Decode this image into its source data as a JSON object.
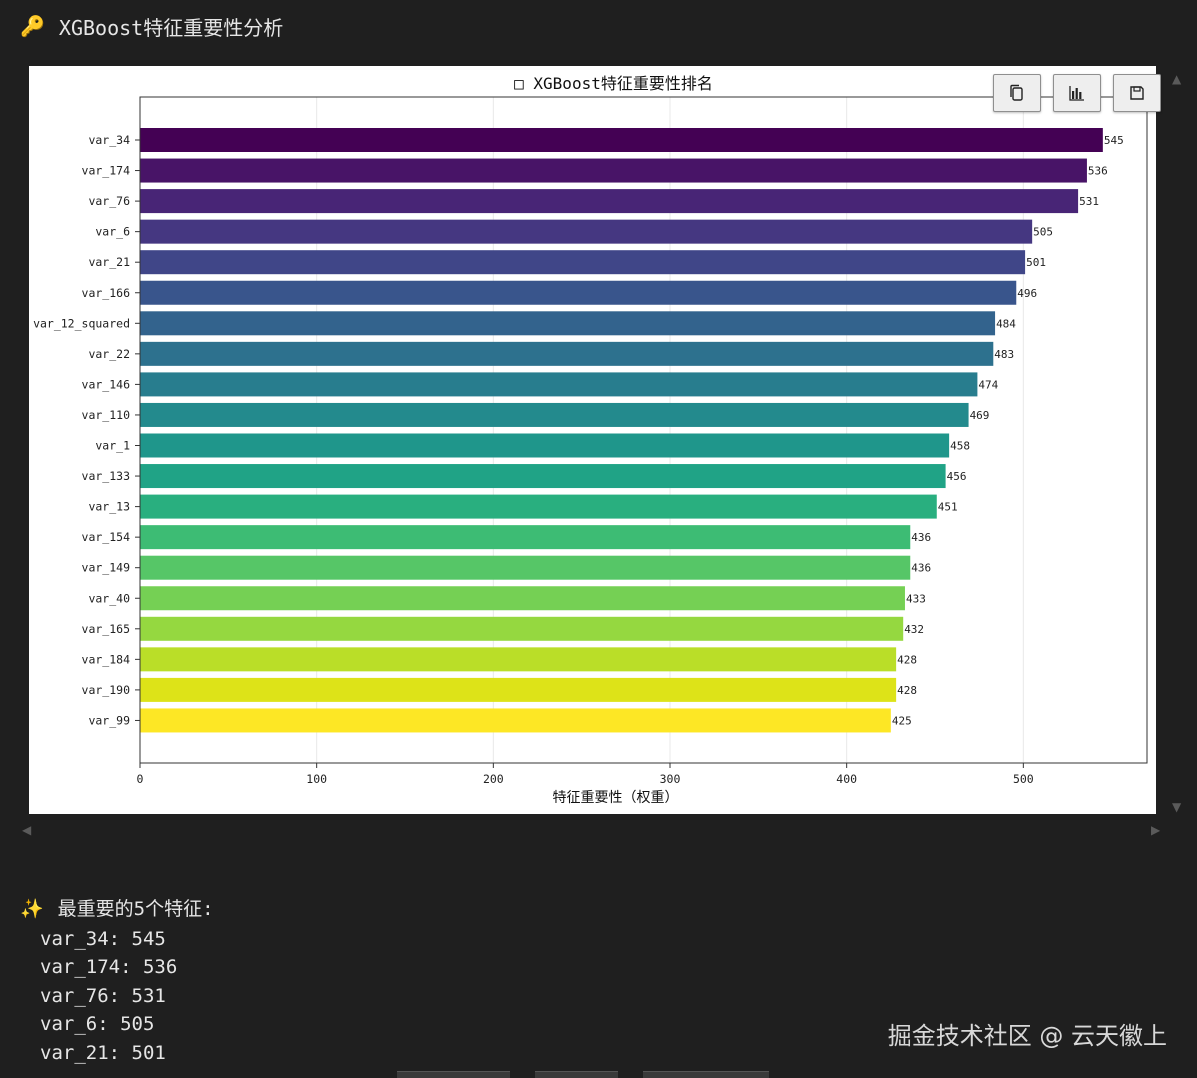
{
  "header": {
    "icon": "key-icon",
    "emoji": "🔑",
    "title": "XGBoost特征重要性分析"
  },
  "toolbar": {
    "buttons": [
      "copy-icon",
      "chart-icon",
      "save-icon"
    ]
  },
  "chart_data": {
    "type": "bar",
    "orientation": "horizontal",
    "title": "□ XGBoost特征重要性排名",
    "xlabel": "特征重要性（权重）",
    "ylabel": "",
    "xlim": [
      0,
      570
    ],
    "xticks": [
      0,
      100,
      200,
      300,
      400,
      500
    ],
    "grid": "vertical",
    "colormap": "viridis",
    "categories": [
      "var_34",
      "var_174",
      "var_76",
      "var_6",
      "var_21",
      "var_166",
      "var_12_squared",
      "var_22",
      "var_146",
      "var_110",
      "var_1",
      "var_133",
      "var_13",
      "var_154",
      "var_149",
      "var_40",
      "var_165",
      "var_184",
      "var_190",
      "var_99"
    ],
    "values": [
      545,
      536,
      531,
      505,
      501,
      496,
      484,
      483,
      474,
      469,
      458,
      456,
      451,
      436,
      436,
      433,
      432,
      428,
      428,
      425
    ],
    "colors": [
      "#440154",
      "#481467",
      "#482576",
      "#453781",
      "#404688",
      "#39558c",
      "#33638d",
      "#2d718e",
      "#287d8e",
      "#238a8d",
      "#1f968b",
      "#20a386",
      "#29af7f",
      "#3dbc74",
      "#56c667",
      "#75d054",
      "#95d840",
      "#bade28",
      "#dde318",
      "#fde725"
    ]
  },
  "summary": {
    "emoji": "✨",
    "title": "最重要的5个特征:",
    "items": [
      "var_34: 545",
      "var_174: 536",
      "var_76: 531",
      "var_6: 505",
      "var_21: 501"
    ]
  },
  "watermark": "掘金技术社区 @ 云天徽上"
}
